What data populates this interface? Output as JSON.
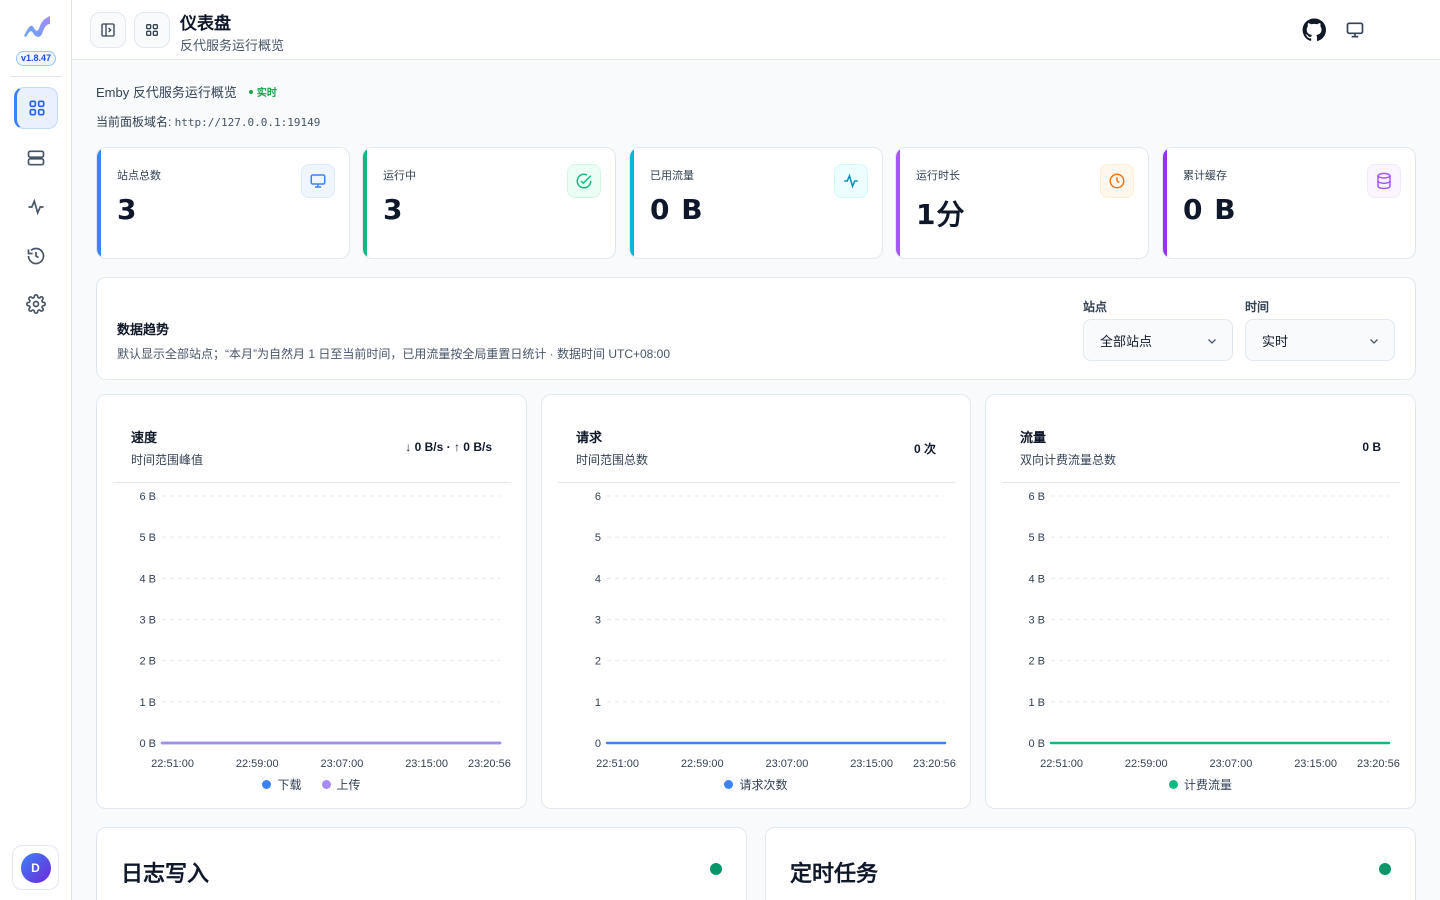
{
  "app": {
    "version": "v1.8.47"
  },
  "sidebar": {
    "items": [
      {
        "name": "dashboard",
        "icon": "grid-icon",
        "active": true
      },
      {
        "name": "servers",
        "icon": "server-icon",
        "active": false
      },
      {
        "name": "activity",
        "icon": "activity-icon",
        "active": false
      },
      {
        "name": "history",
        "icon": "history-icon",
        "active": false
      },
      {
        "name": "settings",
        "icon": "gear-icon",
        "active": false
      }
    ],
    "avatar_initial": "D"
  },
  "header": {
    "title": "仪表盘",
    "subtitle": "反代服务运行概览"
  },
  "intro": {
    "text": "Emby 反代服务运行概览",
    "live_label": "实时",
    "domain_label": "当前面板域名: ",
    "domain_value": "http://127.0.0.1:19149"
  },
  "stats": [
    {
      "label": "站点总数",
      "value": "3",
      "icon": "monitor-icon",
      "color": "#3b82f6"
    },
    {
      "label": "运行中",
      "value": "3",
      "icon": "check-circle-icon",
      "color": "#10b981"
    },
    {
      "label": "已用流量",
      "value": "0 B",
      "icon": "activity-icon",
      "color": "#06b6d4"
    },
    {
      "label": "运行时长",
      "value": "1分",
      "icon": "clock-icon",
      "color": "#f97316"
    },
    {
      "label": "累计缓存",
      "value": "0 B",
      "icon": "database-icon",
      "color": "#a855f7"
    }
  ],
  "trend": {
    "title": "数据趋势",
    "description": "默认显示全部站点；“本月”为自然月 1 日至当前时间，已用流量按全局重置日统计 · 数据时间 UTC+08:00",
    "site_label": "站点",
    "site_value": "全部站点",
    "time_label": "时间",
    "time_value": "实时"
  },
  "charts": [
    {
      "title": "速度",
      "subtitle": "时间范围峰值",
      "value": "↓ 0 B/s · ↑ 0 B/s",
      "legend": [
        {
          "label": "下载",
          "color": "#3b82f6"
        },
        {
          "label": "上传",
          "color": "#a78bfa"
        }
      ]
    },
    {
      "title": "请求",
      "subtitle": "时间范围总数",
      "value": "0 次",
      "legend": [
        {
          "label": "请求次数",
          "color": "#3b82f6"
        }
      ]
    },
    {
      "title": "流量",
      "subtitle": "双向计费流量总数",
      "value": "0 B",
      "legend": [
        {
          "label": "计费流量",
          "color": "#10b981"
        }
      ]
    }
  ],
  "chart_data": [
    {
      "type": "line",
      "title": "速度",
      "x": [
        "22:51:00",
        "22:59:00",
        "23:07:00",
        "23:15:00",
        "23:20:56"
      ],
      "yticks": [
        "0 B",
        "1 B",
        "2 B",
        "3 B",
        "4 B",
        "5 B",
        "6 B"
      ],
      "ylim": [
        0,
        6
      ],
      "grid": true,
      "legend_position": "bottom",
      "series": [
        {
          "name": "下载",
          "values": [
            0,
            0,
            0,
            0,
            0
          ],
          "color": "#3b82f6"
        },
        {
          "name": "上传",
          "values": [
            0,
            0,
            0,
            0,
            0
          ],
          "color": "#a78bfa"
        }
      ]
    },
    {
      "type": "line",
      "title": "请求",
      "x": [
        "22:51:00",
        "22:59:00",
        "23:07:00",
        "23:15:00",
        "23:20:56"
      ],
      "yticks": [
        "0",
        "1",
        "2",
        "3",
        "4",
        "5",
        "6"
      ],
      "ylim": [
        0,
        6
      ],
      "grid": true,
      "legend_position": "bottom",
      "series": [
        {
          "name": "请求次数",
          "values": [
            0,
            0,
            0,
            0,
            0
          ],
          "color": "#3b82f6"
        }
      ]
    },
    {
      "type": "line",
      "title": "流量",
      "x": [
        "22:51:00",
        "22:59:00",
        "23:07:00",
        "23:15:00",
        "23:20:56"
      ],
      "yticks": [
        "0 B",
        "1 B",
        "2 B",
        "3 B",
        "4 B",
        "5 B",
        "6 B"
      ],
      "ylim": [
        0,
        6
      ],
      "grid": true,
      "legend_position": "bottom",
      "series": [
        {
          "name": "计费流量",
          "values": [
            0,
            0,
            0,
            0,
            0
          ],
          "color": "#10b981"
        }
      ]
    }
  ],
  "bottom": [
    {
      "title": "日志写入",
      "status_color": "#059669"
    },
    {
      "title": "定时任务",
      "status_color": "#059669"
    }
  ]
}
